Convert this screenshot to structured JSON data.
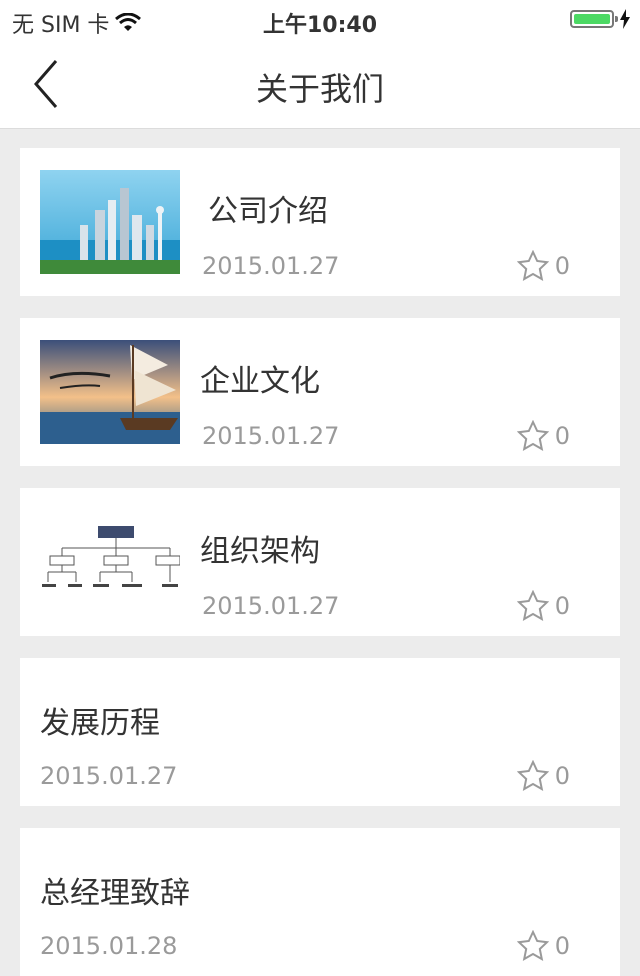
{
  "status_bar": {
    "carrier": "无 SIM 卡",
    "time": "上午10:40",
    "wifi_icon": "wifi-icon",
    "battery_icon": "battery-icon",
    "battery_level": 1.0,
    "battery_color": "#4cd964"
  },
  "nav": {
    "title": "关于我们",
    "back_icon": "chevron-left-icon"
  },
  "items": [
    {
      "title": "公司介绍",
      "date": "2015.01.27",
      "favorites": "0",
      "thumbnail": "city-skyline-image"
    },
    {
      "title": "企业文化",
      "date": "2015.01.27",
      "favorites": "0",
      "thumbnail": "sailing-ship-image"
    },
    {
      "title": "组织架构",
      "date": "2015.01.27",
      "favorites": "0",
      "thumbnail": "org-chart-image"
    },
    {
      "title": "发展历程",
      "date": "2015.01.27",
      "favorites": "0"
    },
    {
      "title": "总经理致辞",
      "date": "2015.01.28",
      "favorites": "0"
    }
  ],
  "colors": {
    "background": "#ececec",
    "card": "#ffffff",
    "date_text": "#9a9a9a",
    "star": "#9a9a9a"
  }
}
